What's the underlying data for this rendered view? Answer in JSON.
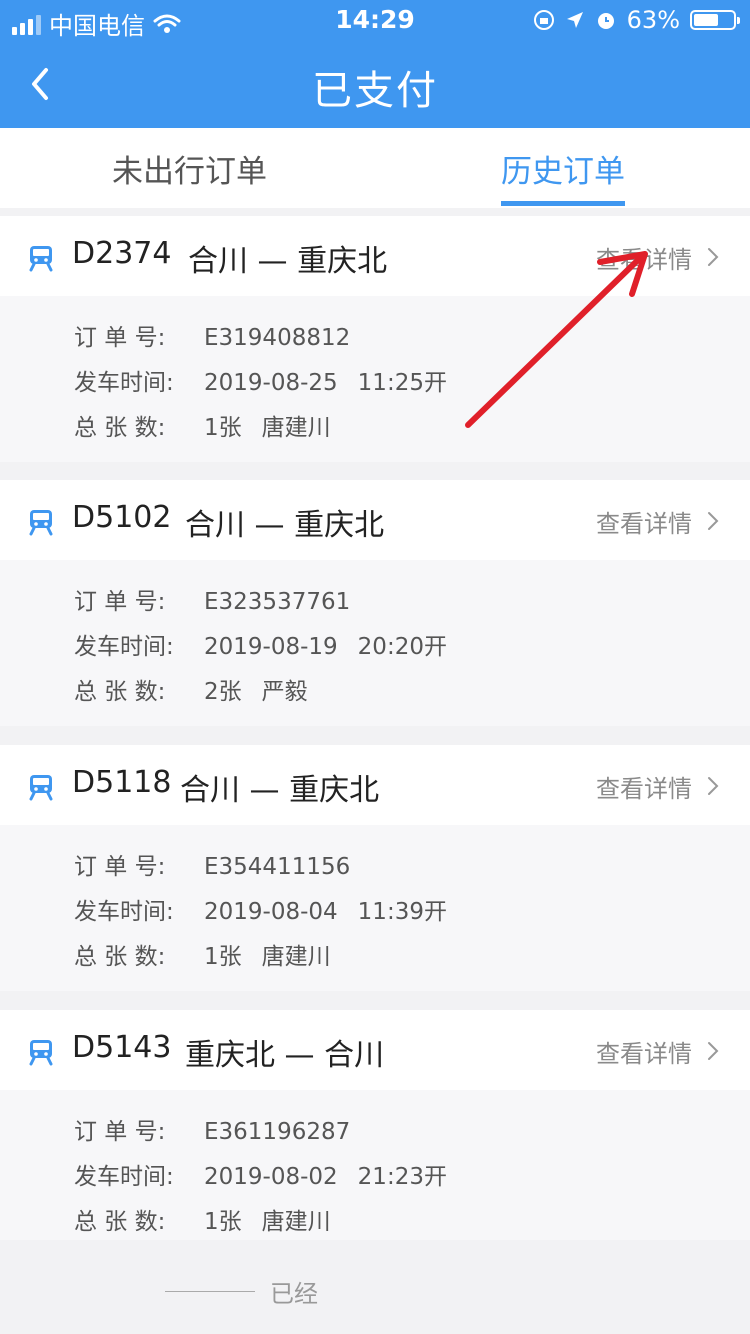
{
  "status_bar": {
    "carrier": "中国电信",
    "time": "14:29",
    "battery": "63%",
    "battery_level": 0.63
  },
  "nav": {
    "title": "已支付",
    "back_icon": "chevron-left-icon"
  },
  "tabs": [
    {
      "label": "未出行订单",
      "active": false
    },
    {
      "label": "历史订单",
      "active": true
    }
  ],
  "orders": [
    {
      "train": "D2374",
      "route": "合川 — 重庆北",
      "detail": "查看详情",
      "order_label": "订 单 号:",
      "order_no": "E319408812",
      "depart_label": "发车时间:",
      "date": "2019-08-25",
      "time": "11:25开",
      "count_label": "总 张 数:",
      "count": "1张",
      "passenger": "唐建川"
    },
    {
      "train": "D5102",
      "route": "合川 — 重庆北",
      "detail": "查看详情",
      "order_label": "订 单 号:",
      "order_no": "E323537761",
      "depart_label": "发车时间:",
      "date": "2019-08-19",
      "time": "20:20开",
      "count_label": "总 张 数:",
      "count": "2张",
      "passenger": "严毅"
    },
    {
      "train": "D5118",
      "route": "合川 — 重庆北",
      "detail": "查看详情",
      "order_label": "订 单 号:",
      "order_no": "E354411156",
      "depart_label": "发车时间:",
      "date": "2019-08-04",
      "time": "11:39开",
      "count_label": "总 张 数:",
      "count": "1张",
      "passenger": "唐建川"
    },
    {
      "train": "D5143",
      "route": "重庆北 — 合川",
      "detail": "查看详情",
      "order_label": "订 单 号:",
      "order_no": "E361196287",
      "depart_label": "发车时间:",
      "date": "2019-08-02",
      "time": "21:23开",
      "count_label": "总 张 数:",
      "count": "1张",
      "passenger": "唐建川"
    }
  ],
  "footer": {
    "text": "已经"
  },
  "colors": {
    "accent": "#3f97f0",
    "arrow": "#e0202a"
  }
}
